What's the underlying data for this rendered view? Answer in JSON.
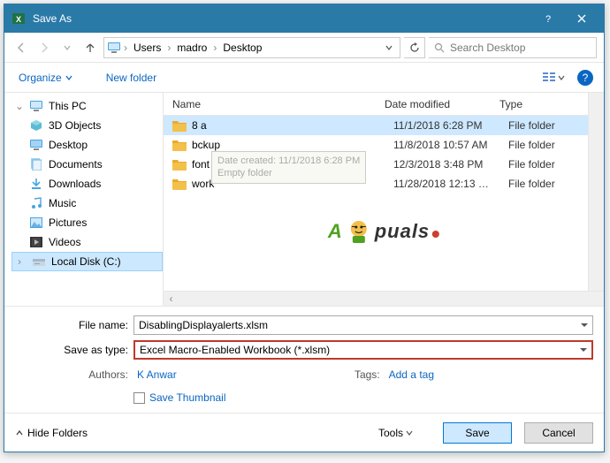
{
  "title": "Save As",
  "breadcrumb": {
    "root_icon": "pc",
    "items": [
      "Users",
      "madro",
      "Desktop"
    ]
  },
  "search": {
    "placeholder": "Search Desktop"
  },
  "toolbar": {
    "organize": "Organize",
    "new_folder": "New folder"
  },
  "sidebar": {
    "root": "This PC",
    "items": [
      "3D Objects",
      "Desktop",
      "Documents",
      "Downloads",
      "Music",
      "Pictures",
      "Videos",
      "Local Disk (C:)"
    ]
  },
  "columns": {
    "name": "Name",
    "date": "Date modified",
    "type": "Type"
  },
  "rows": [
    {
      "name": "8 a",
      "date": "11/1/2018 6:28 PM",
      "type": "File folder",
      "selected": true
    },
    {
      "name": "bckup",
      "date": "11/8/2018 10:57 AM",
      "type": "File folder"
    },
    {
      "name": "font",
      "date": "12/3/2018 3:48 PM",
      "type": "File folder",
      "tooltip": "Date created: 11/1/2018 6:28 PM\nEmpty folder"
    },
    {
      "name": "work",
      "date": "11/28/2018 12:13 …",
      "type": "File folder"
    }
  ],
  "form": {
    "filename_label": "File name:",
    "filename_value": "DisablingDisplayalerts.xlsm",
    "savetype_label": "Save as type:",
    "savetype_value": "Excel Macro-Enabled Workbook (*.xlsm)",
    "authors_label": "Authors:",
    "authors_value": "K Anwar",
    "tags_label": "Tags:",
    "tags_value": "Add a tag",
    "save_thumb": "Save Thumbnail"
  },
  "footer": {
    "hide": "Hide Folders",
    "tools": "Tools",
    "save": "Save",
    "cancel": "Cancel"
  },
  "watermark": {
    "a": "A",
    "p": "puals",
    "dot_color": "#cf3d2e"
  }
}
